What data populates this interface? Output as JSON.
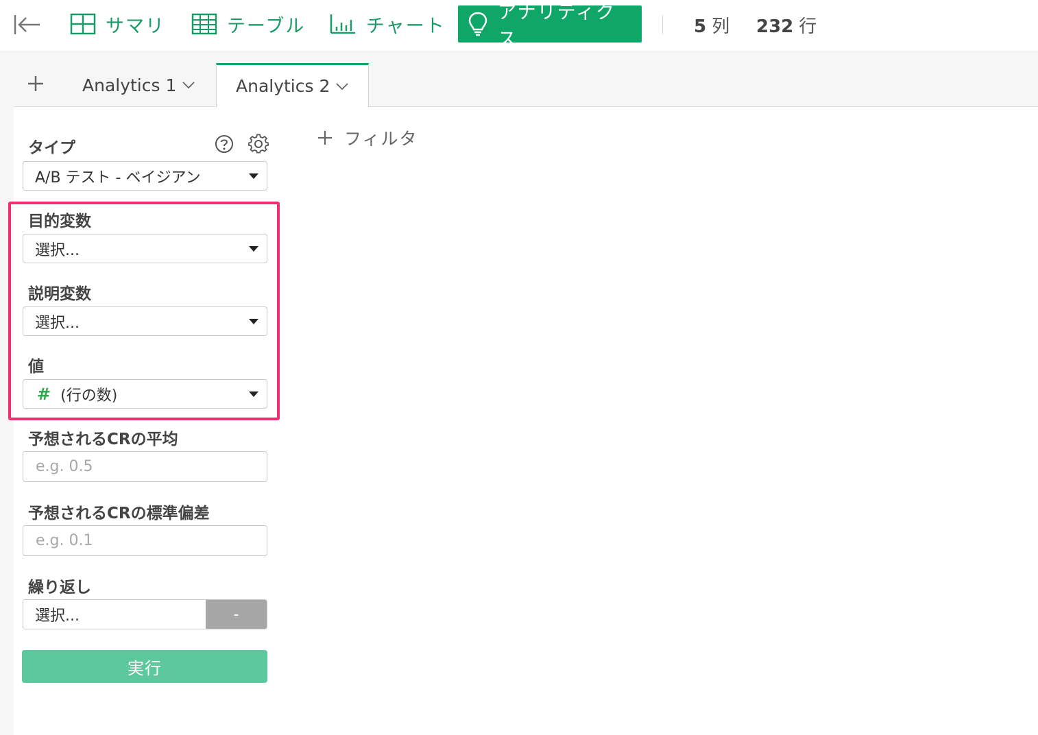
{
  "toolbar": {
    "nav": [
      {
        "label": "サマリ",
        "icon": "summary-grid-icon"
      },
      {
        "label": "テーブル",
        "icon": "table-icon"
      },
      {
        "label": "チャート",
        "icon": "bar-chart-icon"
      },
      {
        "label": "アナリティクス",
        "icon": "lightbulb-icon",
        "active": true
      }
    ],
    "columns_count": "5",
    "columns_unit": "列",
    "rows_count": "232",
    "rows_unit": "行"
  },
  "tabs": {
    "items": [
      {
        "label": "Analytics 1"
      },
      {
        "label": "Analytics 2",
        "active": true
      }
    ]
  },
  "panel": {
    "type_label": "タイプ",
    "type_value": "A/B テスト - ベイジアン",
    "target_label": "目的変数",
    "target_value": "選択...",
    "explanatory_label": "説明変数",
    "explanatory_value": "選択...",
    "value_label": "値",
    "value_symbol": "#",
    "value_value": "(行の数)",
    "mean_label": "予想されるCRの平均",
    "mean_placeholder": "e.g. 0.5",
    "sd_label": "予想されるCRの標準偏差",
    "sd_placeholder": "e.g. 0.1",
    "repeat_label": "繰り返し",
    "repeat_value": "選択...",
    "repeat_right": "-",
    "run_label": "実行"
  },
  "filter": {
    "label": "フィルタ"
  },
  "colors": {
    "accent": "#10a667",
    "run_button": "#5dc89b",
    "highlight": "#f0306e"
  }
}
